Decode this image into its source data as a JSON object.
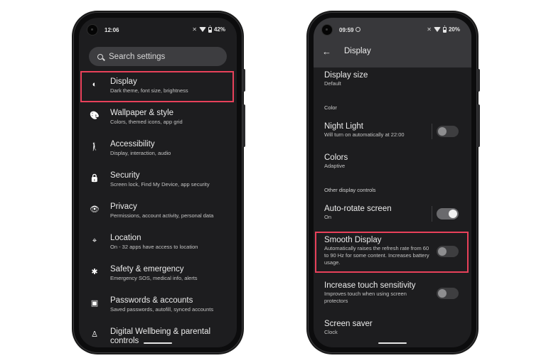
{
  "left_phone": {
    "status": {
      "time": "12:06",
      "battery": "42%",
      "icons": [
        "vibrate-off-icon",
        "wifi-icon",
        "battery-icon"
      ]
    },
    "search": {
      "placeholder": "Search settings",
      "icon": "search-icon"
    },
    "items": [
      {
        "title": "Display",
        "subtitle": "Dark theme, font size, brightness",
        "icon": "brightness-icon",
        "glyph": "◐",
        "highlighted": true
      },
      {
        "title": "Wallpaper & style",
        "subtitle": "Colors, themed icons, app grid",
        "icon": "palette-icon",
        "glyph": "🎨"
      },
      {
        "title": "Accessibility",
        "subtitle": "Display, interaction, audio",
        "icon": "accessibility-icon",
        "glyph": "🚶"
      },
      {
        "title": "Security",
        "subtitle": "Screen lock, Find My Device, app security",
        "icon": "lock-icon",
        "glyph": "🔒"
      },
      {
        "title": "Privacy",
        "subtitle": "Permissions, account activity, personal data",
        "icon": "privacy-eye-icon",
        "glyph": "👁"
      },
      {
        "title": "Location",
        "subtitle": "On - 32 apps have access to location",
        "icon": "location-pin-icon",
        "glyph": "⌖"
      },
      {
        "title": "Safety & emergency",
        "subtitle": "Emergency SOS, medical info, alerts",
        "icon": "medical-asterisk-icon",
        "glyph": "✱"
      },
      {
        "title": "Passwords & accounts",
        "subtitle": "Saved passwords, autofill, synced accounts",
        "icon": "account-box-icon",
        "glyph": "▣"
      },
      {
        "title": "Digital Wellbeing & parental controls",
        "subtitle": "",
        "icon": "wellbeing-icon",
        "glyph": "♙"
      }
    ]
  },
  "right_phone": {
    "status": {
      "time": "09:59",
      "battery": "20%",
      "icons": [
        "settings-gear-icon",
        "vibrate-off-icon",
        "wifi-icon",
        "battery-icon"
      ]
    },
    "appbar": {
      "title": "Display",
      "back_icon": "back-arrow-icon",
      "back_glyph": "←"
    },
    "rows": {
      "display_size": {
        "title": "Display size",
        "subtitle": "Default"
      },
      "cat_color": "Color",
      "night_light": {
        "title": "Night Light",
        "subtitle": "Will turn on automatically at 22:00",
        "toggle": false
      },
      "colors": {
        "title": "Colors",
        "subtitle": "Adaptive"
      },
      "cat_other": "Other display controls",
      "auto_rotate": {
        "title": "Auto-rotate screen",
        "subtitle": "On",
        "toggle": true
      },
      "smooth_display": {
        "title": "Smooth Display",
        "subtitle": "Automatically raises the refresh rate from 60 to 90 Hz for some content. Increases battery usage.",
        "toggle": false,
        "highlighted": true
      },
      "touch_sensitivity": {
        "title": "Increase touch sensitivity",
        "subtitle": "Improves touch when using screen protectors",
        "toggle": false
      },
      "screen_saver": {
        "title": "Screen saver",
        "subtitle": "Clock"
      }
    }
  },
  "colors": {
    "highlight": "#e8415a",
    "screen_bg": "#1d1d1f",
    "appbar_bg": "#38383b"
  }
}
